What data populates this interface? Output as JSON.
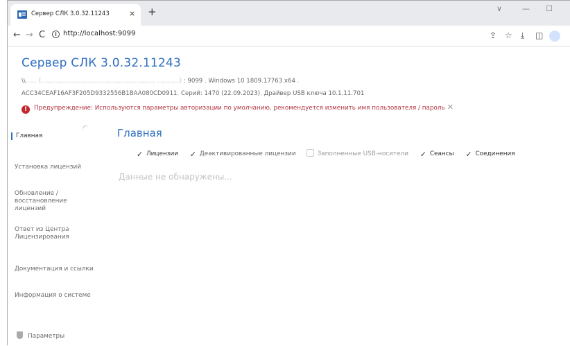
{
  "browser": {
    "tab_title": "Сервер СЛК 3.0.32.11243",
    "tab_close": "×",
    "new_tab": "+",
    "url": "http://localhost:9099",
    "win_minimize": "—",
    "win_maximize": "☐",
    "win_chevron": "∨"
  },
  "header": {
    "title": "Сервер СЛК 3.0.32.11243",
    "host_prefix": "\\\\",
    "host_blurred": "...... (....,...,.,...,...,...,..,.,...,...,...,.,...,...,...,.,..., ...,..,.,...)",
    "port": ": 9099",
    "os": "Windows 10 1809.17763 x64",
    "key_id": "ACC34CEAF16AF3F205D9332556B1BAA080CD0911",
    "serial": "Серий: 1470 (22.09.2023)",
    "driver": "Драйвер USB ключа 10.1.11.701",
    "warning": "Предупреждение: Используются параметры авторизации по умолчанию, рекомендуется изменить имя пользователя / пароль"
  },
  "sidebar": {
    "items": [
      {
        "label": "Главная"
      },
      {
        "label": "Установка лицензий"
      },
      {
        "label": "Обновление / восстановление лицензий"
      },
      {
        "label": "Ответ из Центра Лицензирования"
      },
      {
        "label": "Документация и ссылки"
      },
      {
        "label": "Информация о системе"
      }
    ],
    "params": "Параметры"
  },
  "main": {
    "title": "Главная",
    "filters": [
      {
        "label": "Лицензии",
        "checked": true
      },
      {
        "label": "Деактивированные лицензии",
        "checked": true
      },
      {
        "label": "Заполненные USB-носители",
        "checked": false
      },
      {
        "label": "Сеансы",
        "checked": true
      },
      {
        "label": "Соединения",
        "checked": true
      }
    ],
    "nodata": "Данные не обнаружены..."
  },
  "colors": {
    "accent": "#2f6fc0",
    "warning": "#b2343f"
  }
}
